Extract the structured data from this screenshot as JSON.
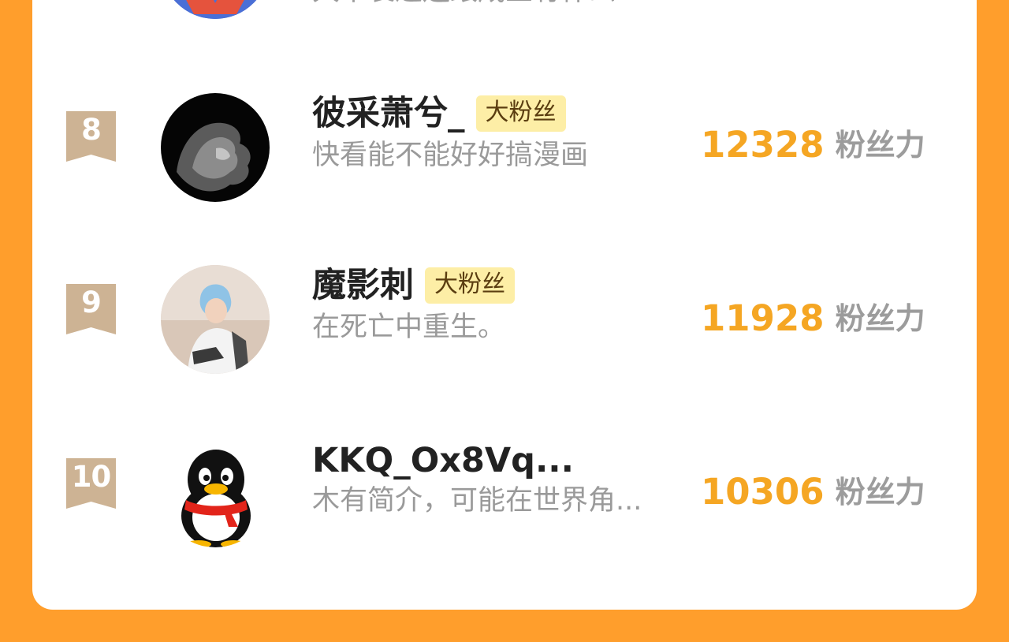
{
  "colors": {
    "background": "#ff9e2c",
    "card": "#ffffff",
    "score": "#f5a623",
    "tag_bg": "#fdeea6",
    "rank_badge": "#cdb394"
  },
  "partial_row": {
    "bio": "大不裹遁还跟咸鱼有什么..."
  },
  "rows": [
    {
      "rank": "8",
      "name": "彼采萧兮_",
      "tag": "大粉丝",
      "bio": "快看能不能好好搞漫画",
      "score": "12328",
      "unit": "粉丝力",
      "avatar_icon": "lion-avatar-icon"
    },
    {
      "rank": "9",
      "name": "魔影刺",
      "tag": "大粉丝",
      "bio": "在死亡中重生。",
      "score": "11928",
      "unit": "粉丝力",
      "avatar_icon": "game-character-avatar-icon"
    },
    {
      "rank": "10",
      "name": "KKQ_Ox8Vq...",
      "tag": "",
      "bio": "木有简介，可能在世界角...",
      "score": "10306",
      "unit": "粉丝力",
      "avatar_icon": "qq-penguin-avatar-icon"
    }
  ]
}
